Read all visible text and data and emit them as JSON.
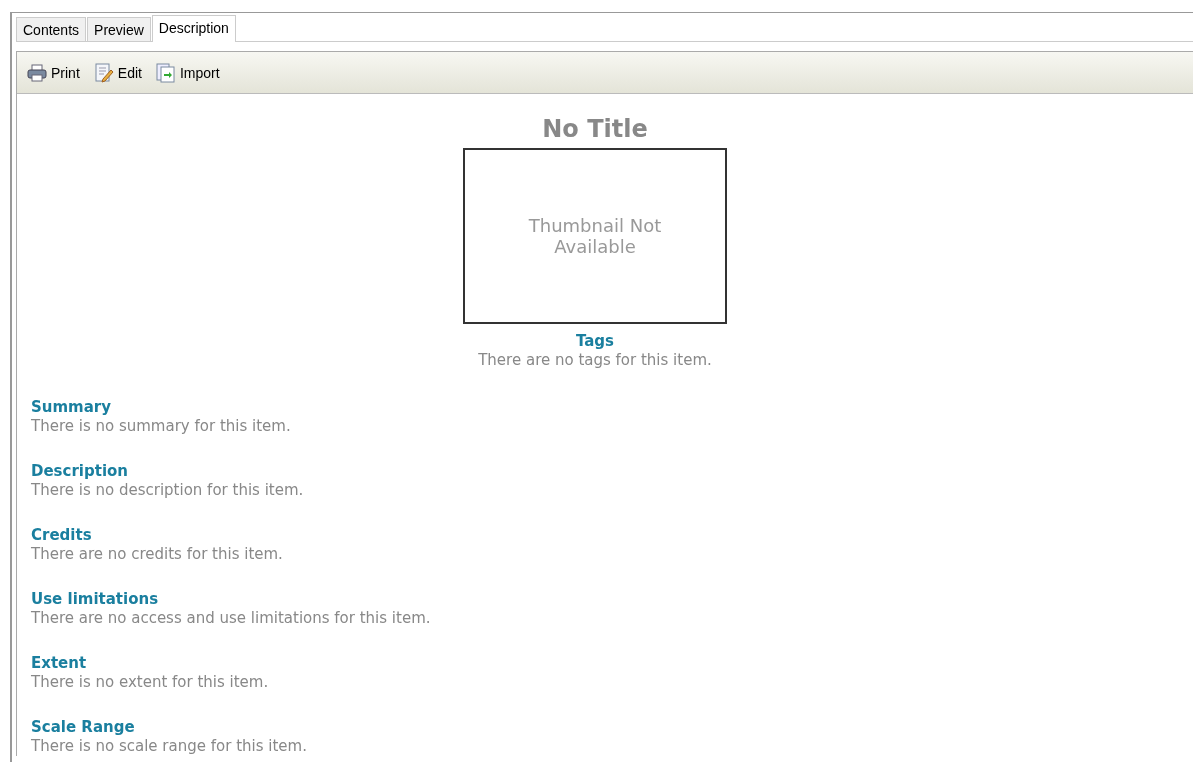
{
  "tabs": [
    {
      "label": "Contents",
      "selected": false
    },
    {
      "label": "Preview",
      "selected": false
    },
    {
      "label": "Description",
      "selected": true
    }
  ],
  "toolbar": [
    {
      "label": "Print",
      "kind": "print"
    },
    {
      "label": "Edit",
      "kind": "edit"
    },
    {
      "label": "Import",
      "kind": "import"
    }
  ],
  "title": "No Title",
  "thumbnail": {
    "text": "Thumbnail Not Available"
  },
  "tags": {
    "heading": "Tags",
    "text": "There are no tags for this item."
  },
  "sections": [
    {
      "heading": "Summary",
      "text": "There is no summary for this item."
    },
    {
      "heading": "Description",
      "text": "There is no description for this item."
    },
    {
      "heading": "Credits",
      "text": "There are no credits for this item."
    },
    {
      "heading": "Use limitations",
      "text": "There are no access and use limitations for this item."
    },
    {
      "heading": "Extent",
      "text": "There is no extent for this item."
    },
    {
      "heading": "Scale Range",
      "text": "There is no scale range for this item."
    }
  ]
}
